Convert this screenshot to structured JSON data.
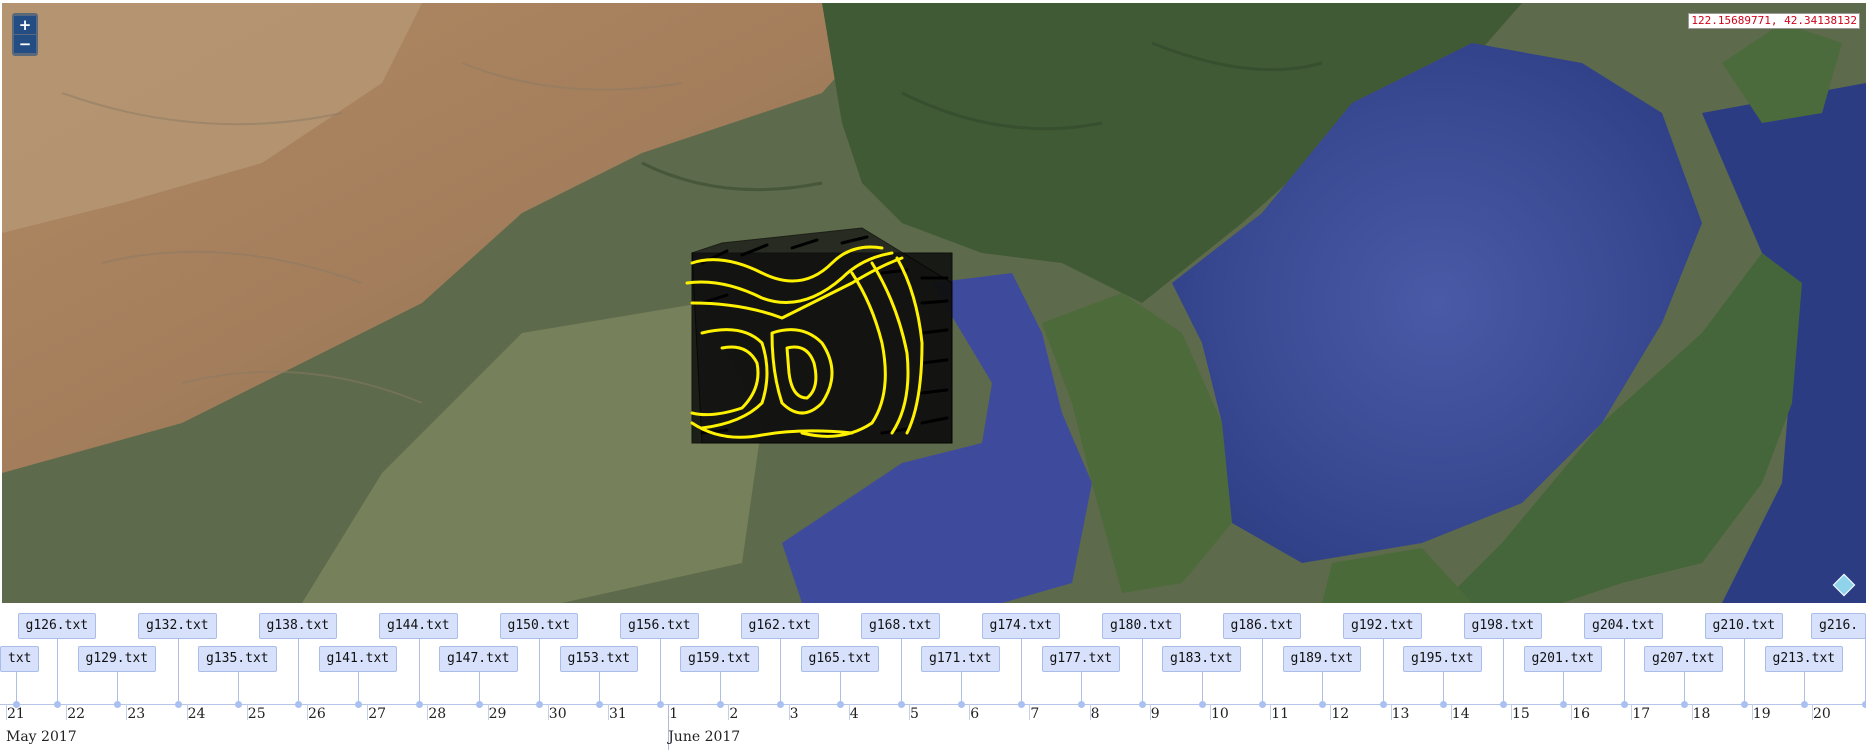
{
  "map": {
    "zoom_in": "+",
    "zoom_out": "−",
    "coordinates": "122.15689771, 42.34138132",
    "icons": [
      "zoom-in-icon",
      "zoom-out-icon",
      "attribution-diamond-icon"
    ]
  },
  "timeline": {
    "months": [
      "May 2017",
      "June 2017"
    ],
    "days": [
      "21",
      "22",
      "23",
      "24",
      "25",
      "26",
      "27",
      "28",
      "29",
      "30",
      "31",
      "1",
      "2",
      "3",
      "4",
      "5",
      "6",
      "7",
      "8",
      "9",
      "10",
      "11",
      "12",
      "13",
      "14",
      "15",
      "16",
      "17",
      "18",
      "19",
      "20"
    ],
    "items_top": [
      "g126.txt",
      "g132.txt",
      "g138.txt",
      "g144.txt",
      "g150.txt",
      "g156.txt",
      "g162.txt",
      "g168.txt",
      "g174.txt",
      "g180.txt",
      "g186.txt",
      "g192.txt",
      "g198.txt",
      "g204.txt",
      "g210.txt",
      "g216."
    ],
    "items_bottom": [
      "txt",
      "g129.txt",
      "g135.txt",
      "g141.txt",
      "g147.txt",
      "g153.txt",
      "g159.txt",
      "g165.txt",
      "g171.txt",
      "g177.txt",
      "g183.txt",
      "g189.txt",
      "g195.txt",
      "g201.txt",
      "g207.txt",
      "g213.txt"
    ]
  }
}
